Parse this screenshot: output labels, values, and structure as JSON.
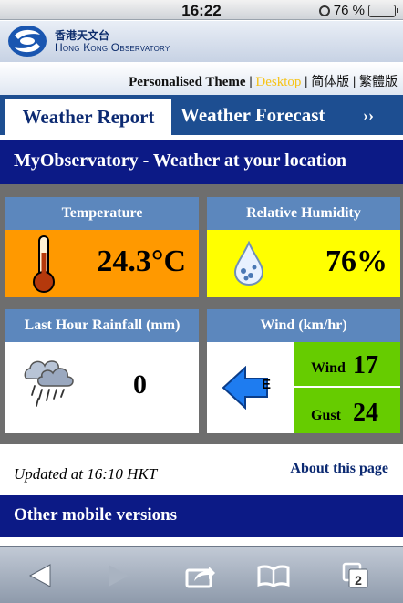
{
  "status_bar": {
    "time": "16:22",
    "battery": "76 %"
  },
  "header": {
    "org_cn": "香港天文台",
    "org_en": "Hong Kong Observatory"
  },
  "theme_bar": {
    "personalised": "Personalised Theme",
    "desktop": "Desktop",
    "simplified": "简体版",
    "traditional": "繁體版"
  },
  "tabs": [
    {
      "label": "Weather Report"
    },
    {
      "label": "Weather Forecast"
    },
    {
      "label": "››"
    }
  ],
  "page_title": "MyObservatory - Weather at your location",
  "cards": {
    "temperature": {
      "title": "Temperature",
      "value": "24.3°C"
    },
    "humidity": {
      "title": "Relative Humidity",
      "value": "76%"
    },
    "rainfall": {
      "title": "Last Hour Rainfall (mm)",
      "value": "0"
    },
    "wind": {
      "title": "Wind (km/hr)",
      "direction": "E",
      "wind_label": "Wind",
      "wind_value": "17",
      "gust_label": "Gust",
      "gust_value": "24"
    }
  },
  "updated": "Updated at 16:10 HKT",
  "about_link": "About this page",
  "other_versions": "Other mobile versions",
  "toolbar": {
    "tabs_count": "2"
  },
  "colors": {
    "temp_bg": "#ff9900",
    "humidity_bg": "#ffff00",
    "wind_bg": "#66cc00",
    "nav_blue": "#0c1a86"
  }
}
